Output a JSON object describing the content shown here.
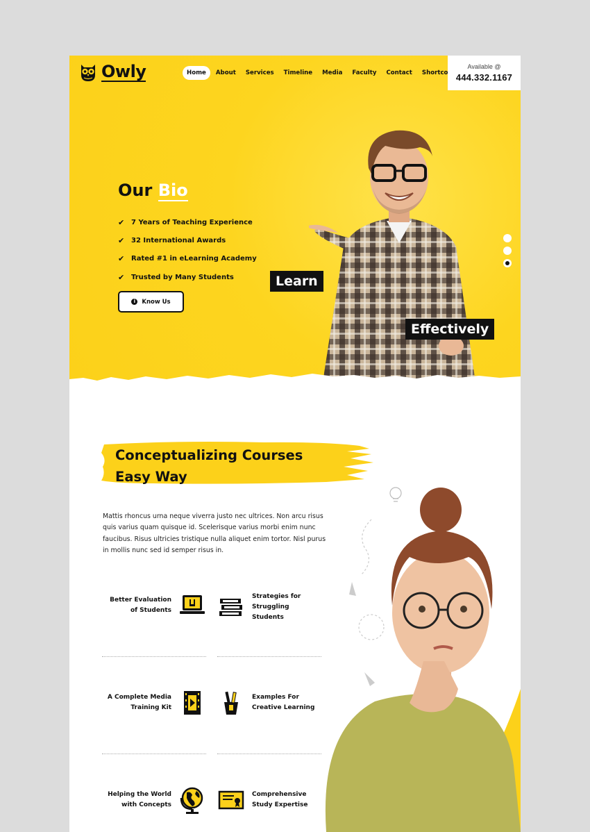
{
  "brand": {
    "name": "Owly"
  },
  "nav": {
    "items": [
      "Home",
      "About",
      "Services",
      "Timeline",
      "Media",
      "Faculty",
      "Contact",
      "Shortcodes"
    ],
    "active": "Home"
  },
  "contact": {
    "label": "Available @",
    "phone": "444.332.1167"
  },
  "hero": {
    "title_prefix": "Our",
    "title_highlight": "Bio",
    "bullets": [
      "7 Years of Teaching Experience",
      "32 International Awards",
      "Rated #1 in eLearning Academy",
      "Trusted by Many Students"
    ],
    "button_label": "Know Us",
    "tag_1": "Learn",
    "tag_2": "Effectively",
    "slider": {
      "count": 3,
      "active_index": 2
    }
  },
  "courses": {
    "title_line1": "Conceptualizing Courses",
    "title_line2": "Easy Way",
    "paragraph": "Mattis rhoncus urna neque viverra justo nec ultrices. Non arcu risus quis varius quam quisque id. Scelerisque varius morbi enim nunc faucibus. Risus ultricies tristique nulla aliquet enim tortor. Nisl purus in mollis nunc sed id semper risus in.",
    "features": [
      {
        "label": "Better Evaluation of Students",
        "icon": "laptop-icon"
      },
      {
        "label": "Strategies for Struggling Students",
        "icon": "books-icon"
      },
      {
        "label": "A Complete Media Training Kit",
        "icon": "film-icon"
      },
      {
        "label": "Examples For Creative Learning",
        "icon": "pencil-cup-icon"
      },
      {
        "label": "Helping the World with Concepts",
        "icon": "globe-icon"
      },
      {
        "label": "Comprehensive Study Expertise",
        "icon": "certificate-icon"
      }
    ]
  },
  "colors": {
    "accent": "#fcd11a",
    "dark": "#111111",
    "white": "#ffffff"
  }
}
